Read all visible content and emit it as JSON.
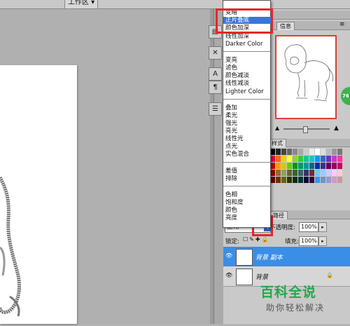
{
  "toolbar": {
    "workspace_label": "工作区 ▾"
  },
  "blend_menu": {
    "items": [
      {
        "label": "变暗",
        "group": 1
      },
      {
        "label": "正片叠底",
        "group": 1,
        "selected": true
      },
      {
        "label": "颜色加深",
        "group": 1
      },
      {
        "label": "线性加深",
        "group": 1
      },
      {
        "label": "Darker Color",
        "group": 1
      },
      {
        "label": "变亮",
        "group": 2
      },
      {
        "label": "滤色",
        "group": 2
      },
      {
        "label": "颜色减淡",
        "group": 2
      },
      {
        "label": "线性减淡",
        "group": 2
      },
      {
        "label": "Lighter Color",
        "group": 2
      },
      {
        "label": "叠加",
        "group": 3
      },
      {
        "label": "柔光",
        "group": 3
      },
      {
        "label": "强光",
        "group": 3
      },
      {
        "label": "亮光",
        "group": 3
      },
      {
        "label": "线性光",
        "group": 3
      },
      {
        "label": "点光",
        "group": 3
      },
      {
        "label": "实色混合",
        "group": 3
      },
      {
        "label": "差值",
        "group": 4
      },
      {
        "label": "排除",
        "group": 4
      },
      {
        "label": "色相",
        "group": 5
      },
      {
        "label": "饱和度",
        "group": 5
      },
      {
        "label": "颜色",
        "group": 5
      },
      {
        "label": "亮度",
        "group": 5
      }
    ],
    "selection_color": "#3a76d8"
  },
  "navigator": {
    "tabs": [
      "信息"
    ],
    "badge": "76"
  },
  "swatches": {
    "tab": "样式"
  },
  "layers": {
    "tab": "路径",
    "blend_mode": "正常",
    "opacity_label": "不透明度:",
    "opacity_value": "100%",
    "lock_label": "锁定:",
    "fill_label": "填充:",
    "fill_value": "100%",
    "items": [
      {
        "name": "背景 副本",
        "selected": true
      },
      {
        "name": "背景",
        "locked": true
      }
    ],
    "selected_color": "#3a8ee6"
  },
  "highlight_color": "#e5262b",
  "watermark": {
    "title": "百科全说",
    "subtitle": "助你轻松解决",
    "color": "#22a84b"
  }
}
